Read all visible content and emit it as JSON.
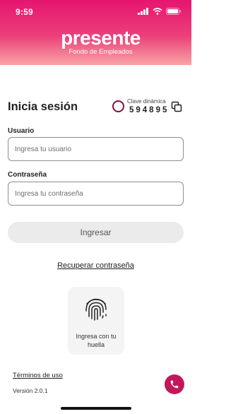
{
  "status_bar": {
    "time": "9:59"
  },
  "brand": {
    "name": "presente",
    "subtitle": "Fondo de Empleados"
  },
  "login": {
    "title": "Inicia sesión",
    "dynamic_key": {
      "label": "Clave dinámica",
      "code": "594895"
    },
    "username": {
      "label": "Usuario",
      "placeholder": "Ingresa tu usuario",
      "value": ""
    },
    "password": {
      "label": "Contraseña",
      "placeholder": "Ingresa tu contraseña",
      "value": ""
    },
    "submit_label": "Ingresar",
    "recover_label": "Recuperar contraseña",
    "fingerprint_label": "Ingresa con tu huella"
  },
  "footer": {
    "terms_label": "Términos de uso",
    "version": "Versión 2.0.1"
  },
  "colors": {
    "brand_pink": "#e5156f",
    "dynamic_ring": "#7a1440",
    "call_button": "#c2185b"
  }
}
